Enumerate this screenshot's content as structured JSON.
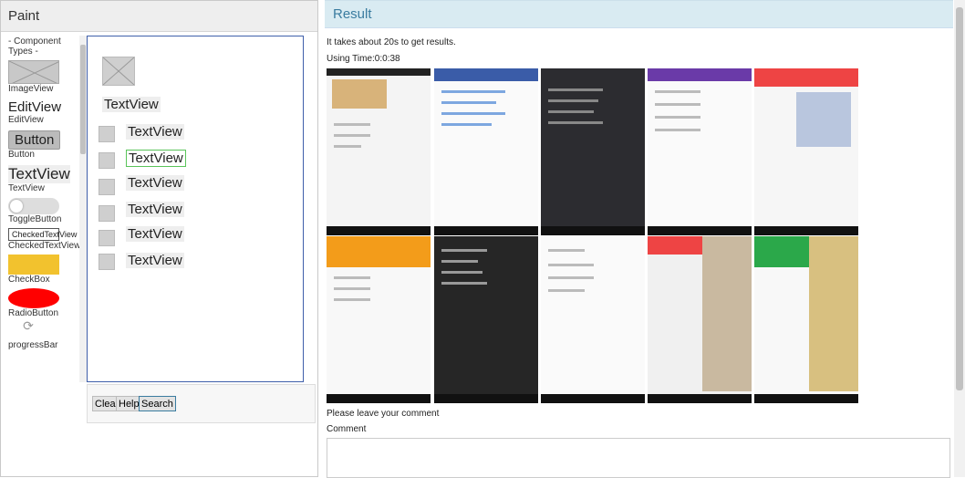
{
  "left": {
    "title": "Paint"
  },
  "palette": {
    "group": "- Component Types -",
    "items": [
      "ImageView",
      "TextView",
      "EditView",
      "Button",
      "TextView",
      "ToggleButton",
      "CheckedTextView",
      "CheckBox",
      "RadioButton",
      "progressBar"
    ],
    "samples": {
      "textview": "TextView",
      "editview": "EditView",
      "button": "Button",
      "textview_big": "TextView",
      "checked": "CheckedTextView"
    }
  },
  "canvas": {
    "tv_label": "TextView"
  },
  "tools": {
    "clear": "Clear",
    "help": "Help",
    "search": "Search"
  },
  "right": {
    "title": "Result",
    "info1": "It takes about 20s to get results.",
    "info2": "Using Time:0:0:38",
    "comment_prompt": "Please leave your comment",
    "comment_label": "Comment"
  },
  "colors": {
    "header_blue": "#d9ebf2",
    "title_blue": "#3a7ca0",
    "canvas_border": "#3f5faa",
    "selected": "#5ac45a"
  }
}
